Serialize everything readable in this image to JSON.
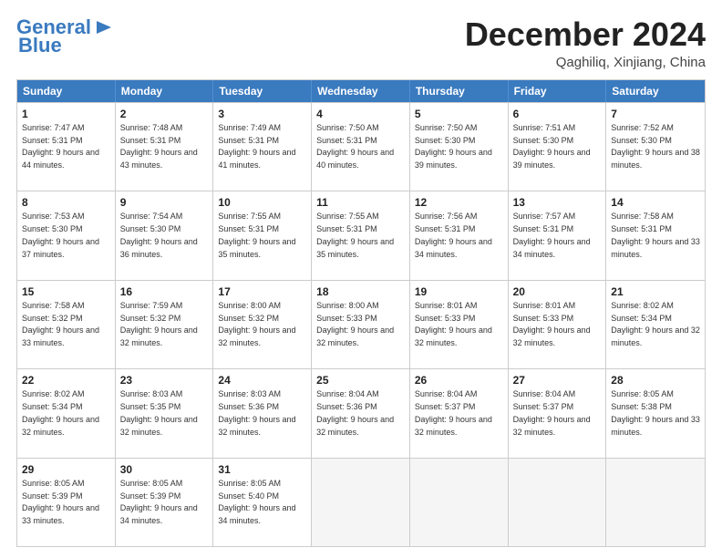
{
  "logo": {
    "line1": "General",
    "line2": "Blue"
  },
  "header": {
    "month": "December 2024",
    "location": "Qaghiliq, Xinjiang, China"
  },
  "weekdays": [
    "Sunday",
    "Monday",
    "Tuesday",
    "Wednesday",
    "Thursday",
    "Friday",
    "Saturday"
  ],
  "rows": [
    [
      {
        "day": "1",
        "rise": "7:47 AM",
        "set": "5:31 PM",
        "daylight": "9 hours and 44 minutes."
      },
      {
        "day": "2",
        "rise": "7:48 AM",
        "set": "5:31 PM",
        "daylight": "9 hours and 43 minutes."
      },
      {
        "day": "3",
        "rise": "7:49 AM",
        "set": "5:31 PM",
        "daylight": "9 hours and 41 minutes."
      },
      {
        "day": "4",
        "rise": "7:50 AM",
        "set": "5:31 PM",
        "daylight": "9 hours and 40 minutes."
      },
      {
        "day": "5",
        "rise": "7:50 AM",
        "set": "5:30 PM",
        "daylight": "9 hours and 39 minutes."
      },
      {
        "day": "6",
        "rise": "7:51 AM",
        "set": "5:30 PM",
        "daylight": "9 hours and 39 minutes."
      },
      {
        "day": "7",
        "rise": "7:52 AM",
        "set": "5:30 PM",
        "daylight": "9 hours and 38 minutes."
      }
    ],
    [
      {
        "day": "8",
        "rise": "7:53 AM",
        "set": "5:30 PM",
        "daylight": "9 hours and 37 minutes."
      },
      {
        "day": "9",
        "rise": "7:54 AM",
        "set": "5:30 PM",
        "daylight": "9 hours and 36 minutes."
      },
      {
        "day": "10",
        "rise": "7:55 AM",
        "set": "5:31 PM",
        "daylight": "9 hours and 35 minutes."
      },
      {
        "day": "11",
        "rise": "7:55 AM",
        "set": "5:31 PM",
        "daylight": "9 hours and 35 minutes."
      },
      {
        "day": "12",
        "rise": "7:56 AM",
        "set": "5:31 PM",
        "daylight": "9 hours and 34 minutes."
      },
      {
        "day": "13",
        "rise": "7:57 AM",
        "set": "5:31 PM",
        "daylight": "9 hours and 34 minutes."
      },
      {
        "day": "14",
        "rise": "7:58 AM",
        "set": "5:31 PM",
        "daylight": "9 hours and 33 minutes."
      }
    ],
    [
      {
        "day": "15",
        "rise": "7:58 AM",
        "set": "5:32 PM",
        "daylight": "9 hours and 33 minutes."
      },
      {
        "day": "16",
        "rise": "7:59 AM",
        "set": "5:32 PM",
        "daylight": "9 hours and 32 minutes."
      },
      {
        "day": "17",
        "rise": "8:00 AM",
        "set": "5:32 PM",
        "daylight": "9 hours and 32 minutes."
      },
      {
        "day": "18",
        "rise": "8:00 AM",
        "set": "5:33 PM",
        "daylight": "9 hours and 32 minutes."
      },
      {
        "day": "19",
        "rise": "8:01 AM",
        "set": "5:33 PM",
        "daylight": "9 hours and 32 minutes."
      },
      {
        "day": "20",
        "rise": "8:01 AM",
        "set": "5:33 PM",
        "daylight": "9 hours and 32 minutes."
      },
      {
        "day": "21",
        "rise": "8:02 AM",
        "set": "5:34 PM",
        "daylight": "9 hours and 32 minutes."
      }
    ],
    [
      {
        "day": "22",
        "rise": "8:02 AM",
        "set": "5:34 PM",
        "daylight": "9 hours and 32 minutes."
      },
      {
        "day": "23",
        "rise": "8:03 AM",
        "set": "5:35 PM",
        "daylight": "9 hours and 32 minutes."
      },
      {
        "day": "24",
        "rise": "8:03 AM",
        "set": "5:36 PM",
        "daylight": "9 hours and 32 minutes."
      },
      {
        "day": "25",
        "rise": "8:04 AM",
        "set": "5:36 PM",
        "daylight": "9 hours and 32 minutes."
      },
      {
        "day": "26",
        "rise": "8:04 AM",
        "set": "5:37 PM",
        "daylight": "9 hours and 32 minutes."
      },
      {
        "day": "27",
        "rise": "8:04 AM",
        "set": "5:37 PM",
        "daylight": "9 hours and 32 minutes."
      },
      {
        "day": "28",
        "rise": "8:05 AM",
        "set": "5:38 PM",
        "daylight": "9 hours and 33 minutes."
      }
    ],
    [
      {
        "day": "29",
        "rise": "8:05 AM",
        "set": "5:39 PM",
        "daylight": "9 hours and 33 minutes."
      },
      {
        "day": "30",
        "rise": "8:05 AM",
        "set": "5:39 PM",
        "daylight": "9 hours and 34 minutes."
      },
      {
        "day": "31",
        "rise": "8:05 AM",
        "set": "5:40 PM",
        "daylight": "9 hours and 34 minutes."
      },
      null,
      null,
      null,
      null
    ]
  ]
}
